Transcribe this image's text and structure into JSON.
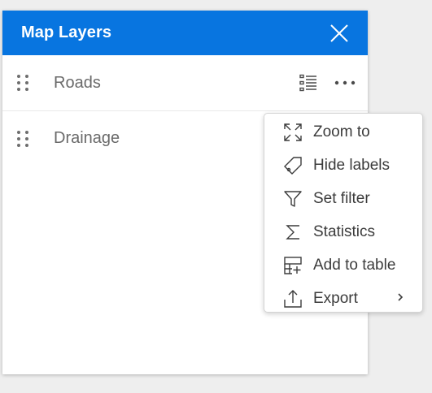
{
  "panel": {
    "title": "Map Layers",
    "header_color": "#0875e0"
  },
  "icons": {
    "close": "close-icon",
    "drag": "drag-handle-icon",
    "legend": "legend-list-icon",
    "more": "more-dots-icon"
  },
  "layers": [
    {
      "label": "Roads"
    },
    {
      "label": "Drainage"
    }
  ],
  "menu": {
    "items": [
      {
        "label": "Zoom to",
        "icon": "zoom-to-icon"
      },
      {
        "label": "Hide labels",
        "icon": "tag-icon"
      },
      {
        "label": "Set filter",
        "icon": "filter-icon"
      },
      {
        "label": "Statistics",
        "icon": "sigma-icon"
      },
      {
        "label": "Add to table",
        "icon": "add-table-icon"
      },
      {
        "label": "Export",
        "icon": "export-icon",
        "submenu": true
      }
    ]
  }
}
